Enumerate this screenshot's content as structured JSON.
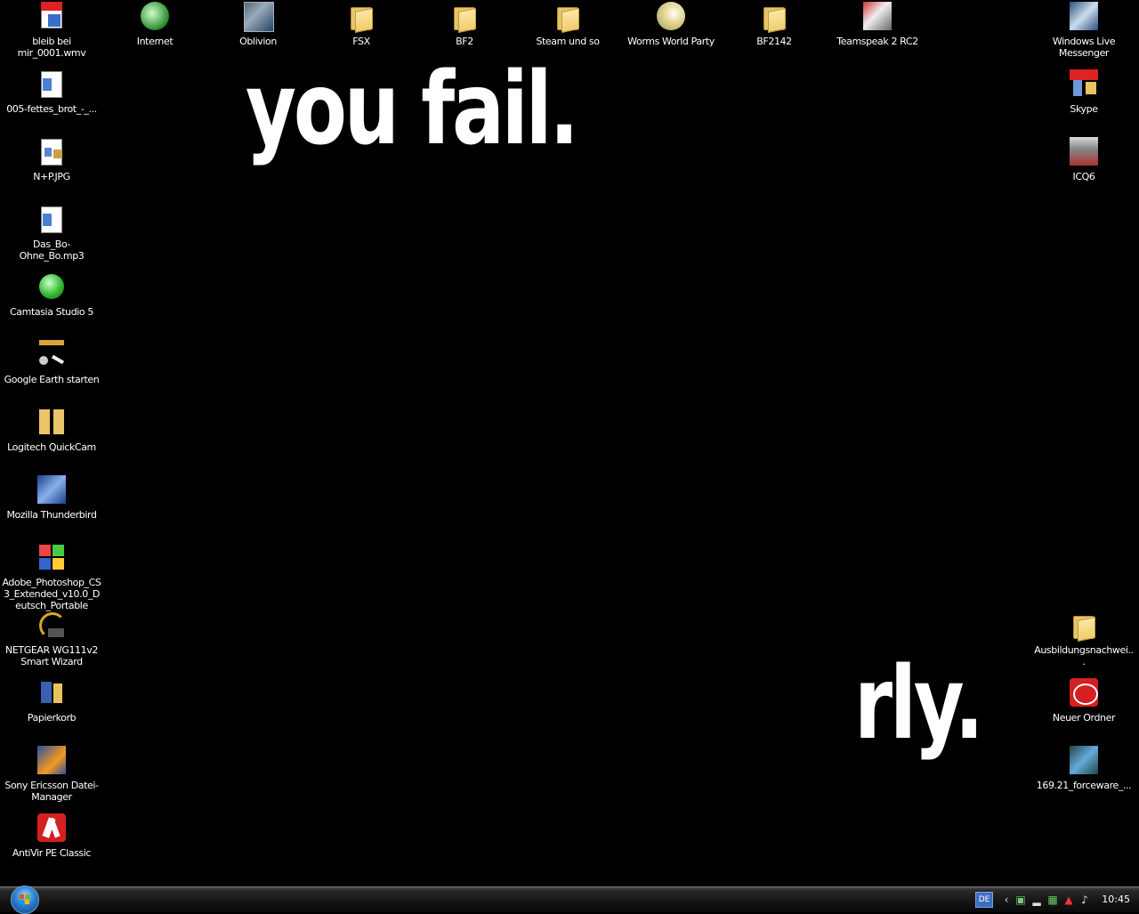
{
  "wallpaper": {
    "line1": "you fail.",
    "line2": "rly."
  },
  "icons_top": [
    {
      "label": "bleib bei mir_0001.wmv",
      "icon": "video-file-icon"
    },
    {
      "label": "Internet",
      "icon": "internet-icon"
    },
    {
      "label": "Oblivion",
      "icon": "game-icon"
    },
    {
      "label": "FSX",
      "icon": "folder-icon"
    },
    {
      "label": "BF2",
      "icon": "folder-icon"
    },
    {
      "label": "Steam und so",
      "icon": "folder-icon"
    },
    {
      "label": "Worms World Party",
      "icon": "game-icon"
    },
    {
      "label": "BF2142",
      "icon": "folder-icon"
    },
    {
      "label": "Teamspeak 2 RC2",
      "icon": "app-icon"
    }
  ],
  "icons_left": [
    {
      "label": "005-fettes_brot_-_...",
      "icon": "audio-file-icon"
    },
    {
      "label": "N+P.JPG",
      "icon": "image-file-icon"
    },
    {
      "label": "Das_Bo-Ohne_Bo.mp3",
      "icon": "audio-file-icon"
    },
    {
      "label": "Camtasia Studio 5",
      "icon": "app-icon"
    },
    {
      "label": "Google Earth starten",
      "icon": "app-icon"
    },
    {
      "label": "Logitech QuickCam",
      "icon": "app-icon"
    },
    {
      "label": "Mozilla Thunderbird",
      "icon": "app-icon"
    },
    {
      "label": "Adobe_Photoshop_CS3_Extended_v10.0_Deutsch_Portable",
      "icon": "app-icon"
    },
    {
      "label": "NETGEAR WG111v2 Smart Wizard",
      "icon": "app-icon"
    },
    {
      "label": "Papierkorb",
      "icon": "recycle-bin-icon"
    },
    {
      "label": "Sony Ericsson Datei-Manager",
      "icon": "app-icon"
    },
    {
      "label": "AntiVir PE Classic",
      "icon": "antivirus-icon"
    }
  ],
  "icons_right": [
    {
      "label": "Windows Live Messenger",
      "icon": "messenger-icon"
    },
    {
      "label": "Skype",
      "icon": "skype-icon"
    },
    {
      "label": "ICQ6",
      "icon": "icq-icon"
    },
    {
      "label": "Ausbildungsnachwei...",
      "icon": "folder-icon"
    },
    {
      "label": "Neuer Ordner",
      "icon": "folder-icon"
    },
    {
      "label": "169.21_forceware_...",
      "icon": "app-icon"
    }
  ],
  "taskbar": {
    "language": "DE",
    "clock": "10:45",
    "tray_icons": [
      "chevron-left-icon",
      "network-icon",
      "signal-icon",
      "connection-icon",
      "antivir-icon",
      "volume-icon"
    ]
  },
  "colors": {
    "desktop": "#000000",
    "text": "#ffffff"
  }
}
